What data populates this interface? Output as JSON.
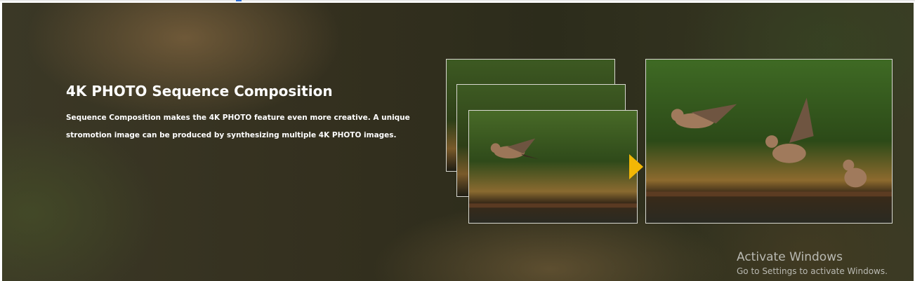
{
  "feature": {
    "title": "4K PHOTO Sequence Composition",
    "description": "Sequence Composition makes the 4K PHOTO feature even more creative. A unique stromotion image can be produced by synthesizing multiple 4K PHOTO images."
  },
  "images": {
    "stack": [
      "bird-frame-1",
      "bird-frame-2",
      "bird-frame-3"
    ],
    "result": "bird-sequence-composite",
    "arrow_color": "#f2b705"
  },
  "watermark": {
    "title": "Activate Windows",
    "subtitle": "Go to Settings to activate Windows."
  }
}
